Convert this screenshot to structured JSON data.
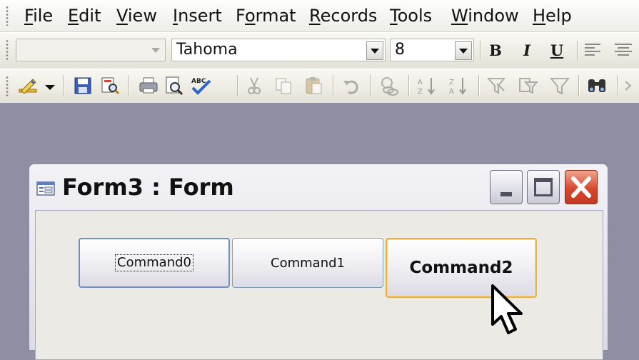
{
  "menu": {
    "items": [
      {
        "accel": "F",
        "rest": "ile"
      },
      {
        "accel": "E",
        "rest": "dit"
      },
      {
        "accel": "V",
        "rest": "iew"
      },
      {
        "accel": "I",
        "rest": "nsert"
      },
      {
        "pre": "F",
        "accel": "o",
        "rest": "rmat"
      },
      {
        "accel": "R",
        "rest": "ecords"
      },
      {
        "accel": "T",
        "rest": "ools"
      },
      {
        "accel": "W",
        "rest": "indow"
      },
      {
        "accel": "H",
        "rest": "elp"
      }
    ]
  },
  "formatting_toolbar": {
    "object_combo_value": "",
    "font_name": "Tahoma",
    "font_size": "8",
    "bold_label": "B",
    "italic_label": "I",
    "underline_label": "U"
  },
  "form_window": {
    "title": "Form3 : Form",
    "buttons": {
      "command0": "Command0",
      "command1": "Command1",
      "command2": "Command2"
    }
  },
  "colors": {
    "workspace": "#8f8fa3",
    "close_button": "#d6492e",
    "hover_border": "#e6b24a",
    "focus_border": "#6f8fc6"
  }
}
